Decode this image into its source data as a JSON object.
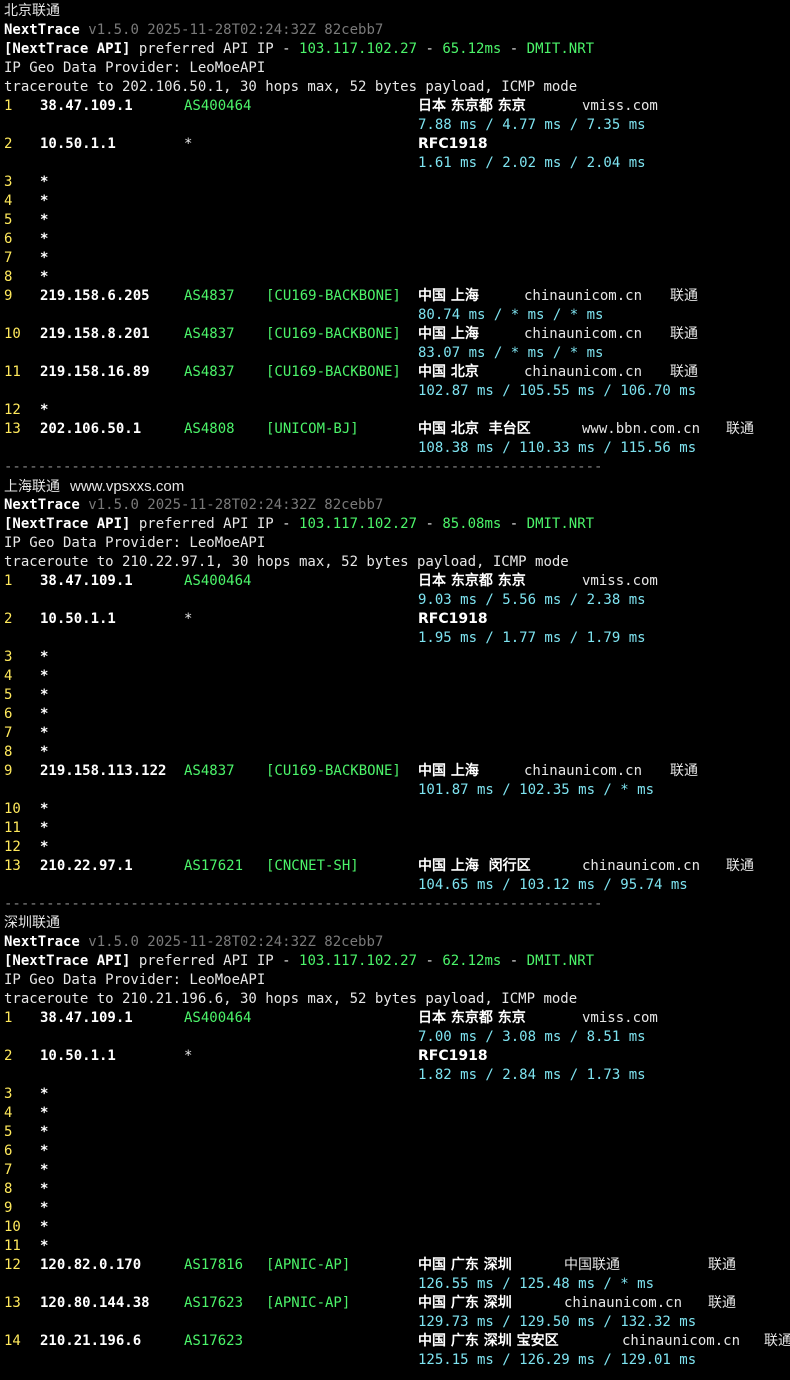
{
  "sections": [
    {
      "title": "北京联通",
      "watermark": "",
      "nexttrace_label": "NextTrace",
      "version_info": "v1.5.0 2025-11-28T02:24:32Z 82cebb7",
      "api": {
        "tag": "[NextTrace API]",
        "text": " preferred API IP - ",
        "ip": "103.117.102.27",
        "dash": " - ",
        "latency": "65.12ms",
        "dash2": " - ",
        "node": "DMIT.NRT"
      },
      "geo_provider": "IP Geo Data Provider: LeoMoeAPI",
      "traceroute": "traceroute to 202.106.50.1, 30 hops max, 52 bytes payload, ICMP mode",
      "hops": [
        {
          "n": "1",
          "ip": "38.47.109.1",
          "as": "AS400464",
          "tag": "",
          "geo": "日本 东京都 东京",
          "domain": "vmiss.com",
          "isp": "",
          "rtt": "7.88 ms / 4.77 ms / 7.35 ms"
        },
        {
          "n": "2",
          "ip": "10.50.1.1",
          "as": "*",
          "tag": "",
          "geo": "RFC1918",
          "domain": "",
          "isp": "",
          "rtt": "1.61 ms / 2.02 ms / 2.04 ms"
        },
        {
          "n": "3",
          "star": "*"
        },
        {
          "n": "4",
          "star": "*"
        },
        {
          "n": "5",
          "star": "*"
        },
        {
          "n": "6",
          "star": "*"
        },
        {
          "n": "7",
          "star": "*"
        },
        {
          "n": "8",
          "star": "*"
        },
        {
          "n": "9",
          "ip": "219.158.6.205",
          "as": "AS4837",
          "tag": "[CU169-BACKBONE]",
          "geo": "中国 上海",
          "domain": "chinaunicom.cn",
          "isp": "联通",
          "rtt": "80.74 ms / * ms / * ms"
        },
        {
          "n": "10",
          "ip": "219.158.8.201",
          "as": "AS4837",
          "tag": "[CU169-BACKBONE]",
          "geo": "中国 上海",
          "domain": "chinaunicom.cn",
          "isp": "联通",
          "rtt": "83.07 ms / * ms / * ms"
        },
        {
          "n": "11",
          "ip": "219.158.16.89",
          "as": "AS4837",
          "tag": "[CU169-BACKBONE]",
          "geo": "中国 北京",
          "domain": "chinaunicom.cn",
          "isp": "联通",
          "rtt": "102.87 ms / 105.55 ms / 106.70 ms"
        },
        {
          "n": "12",
          "star": "*"
        },
        {
          "n": "13",
          "ip": "202.106.50.1",
          "as": "AS4808",
          "tag": "[UNICOM-BJ]",
          "geo": "中国 北京  丰台区",
          "domain": "www.bbn.com.cn",
          "isp": "联通",
          "rtt": "108.38 ms / 110.33 ms / 115.56 ms"
        }
      ],
      "separator": "-----------------------------------------------------------------------"
    },
    {
      "title": "上海联通",
      "watermark": "www.vpsxxs.com",
      "nexttrace_label": "NextTrace",
      "version_info": "v1.5.0 2025-11-28T02:24:32Z 82cebb7",
      "api": {
        "tag": "[NextTrace API]",
        "text": " preferred API IP - ",
        "ip": "103.117.102.27",
        "dash": " - ",
        "latency": "85.08ms",
        "dash2": " - ",
        "node": "DMIT.NRT"
      },
      "geo_provider": "IP Geo Data Provider: LeoMoeAPI",
      "traceroute": "traceroute to 210.22.97.1, 30 hops max, 52 bytes payload, ICMP mode",
      "hops": [
        {
          "n": "1",
          "ip": "38.47.109.1",
          "as": "AS400464",
          "tag": "",
          "geo": "日本 东京都 东京",
          "domain": "vmiss.com",
          "isp": "",
          "rtt": "9.03 ms / 5.56 ms / 2.38 ms"
        },
        {
          "n": "2",
          "ip": "10.50.1.1",
          "as": "*",
          "tag": "",
          "geo": "RFC1918",
          "domain": "",
          "isp": "",
          "rtt": "1.95 ms / 1.77 ms / 1.79 ms"
        },
        {
          "n": "3",
          "star": "*"
        },
        {
          "n": "4",
          "star": "*"
        },
        {
          "n": "5",
          "star": "*"
        },
        {
          "n": "6",
          "star": "*"
        },
        {
          "n": "7",
          "star": "*"
        },
        {
          "n": "8",
          "star": "*"
        },
        {
          "n": "9",
          "ip": "219.158.113.122",
          "as": "AS4837",
          "tag": "[CU169-BACKBONE]",
          "geo": "中国 上海",
          "domain": "chinaunicom.cn",
          "isp": "联通",
          "rtt": "101.87 ms / 102.35 ms / * ms"
        },
        {
          "n": "10",
          "star": "*"
        },
        {
          "n": "11",
          "star": "*"
        },
        {
          "n": "12",
          "star": "*"
        },
        {
          "n": "13",
          "ip": "210.22.97.1",
          "as": "AS17621",
          "tag": "[CNCNET-SH]",
          "geo": "中国 上海  闵行区",
          "domain": "chinaunicom.cn",
          "isp": "联通",
          "rtt": "104.65 ms / 103.12 ms / 95.74 ms"
        }
      ],
      "separator": "-----------------------------------------------------------------------"
    },
    {
      "title": "深圳联通",
      "watermark": "",
      "nexttrace_label": "NextTrace",
      "version_info": "v1.5.0 2025-11-28T02:24:32Z 82cebb7",
      "api": {
        "tag": "[NextTrace API]",
        "text": " preferred API IP - ",
        "ip": "103.117.102.27",
        "dash": " - ",
        "latency": "62.12ms",
        "dash2": " - ",
        "node": "DMIT.NRT"
      },
      "geo_provider": "IP Geo Data Provider: LeoMoeAPI",
      "traceroute": "traceroute to 210.21.196.6, 30 hops max, 52 bytes payload, ICMP mode",
      "hops": [
        {
          "n": "1",
          "ip": "38.47.109.1",
          "as": "AS400464",
          "tag": "",
          "geo": "日本 东京都 东京",
          "domain": "vmiss.com",
          "isp": "",
          "rtt": "7.00 ms / 3.08 ms / 8.51 ms"
        },
        {
          "n": "2",
          "ip": "10.50.1.1",
          "as": "*",
          "tag": "",
          "geo": "RFC1918",
          "domain": "",
          "isp": "",
          "rtt": "1.82 ms / 2.84 ms / 1.73 ms"
        },
        {
          "n": "3",
          "star": "*"
        },
        {
          "n": "4",
          "star": "*"
        },
        {
          "n": "5",
          "star": "*"
        },
        {
          "n": "6",
          "star": "*"
        },
        {
          "n": "7",
          "star": "*"
        },
        {
          "n": "8",
          "star": "*"
        },
        {
          "n": "9",
          "star": "*"
        },
        {
          "n": "10",
          "star": "*"
        },
        {
          "n": "11",
          "star": "*"
        },
        {
          "n": "12",
          "ip": "120.82.0.170",
          "as": "AS17816",
          "tag": "[APNIC-AP]",
          "geo": "中国 广东 深圳",
          "domain": "中国联通",
          "isp": "联通",
          "rtt": "126.55 ms / 125.48 ms / * ms"
        },
        {
          "n": "13",
          "ip": "120.80.144.38",
          "as": "AS17623",
          "tag": "[APNIC-AP]",
          "geo": "中国 广东 深圳",
          "domain": "chinaunicom.cn",
          "isp": "联通",
          "rtt": "129.73 ms / 129.50 ms / 132.32 ms"
        },
        {
          "n": "14",
          "ip": "210.21.196.6",
          "as": "AS17623",
          "tag": "",
          "geo": "中国 广东 深圳 宝安区",
          "domain": "chinaunicom.cn",
          "isp": "联通",
          "rtt": "125.15 ms / 126.29 ms / 129.01 ms"
        }
      ],
      "separator": ""
    }
  ]
}
